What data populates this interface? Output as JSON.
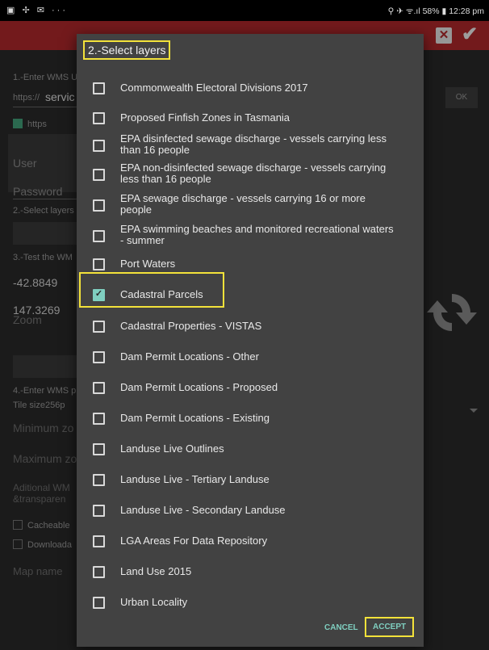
{
  "status_bar": {
    "left_icons": "▣ ✢ ✉ ···",
    "right": "⚲ ✈ ᯤ.ıl 58% ▮ 12:28 pm"
  },
  "app_bar": {
    "discard_icon": "x-box-icon",
    "confirm_icon": "check-icon"
  },
  "background_form": {
    "enter_wms_label": "1.-Enter WMS U",
    "url_prefix": "https://",
    "url_value": "servic",
    "ok_label": "OK",
    "https_label": "https",
    "user_placeholder": "User",
    "password_placeholder": "Password",
    "select_layers_label": "2.-Select layers",
    "test_label": "3.-Test the WM",
    "lat": "-42.8849",
    "lon": "147.3269",
    "zoom_placeholder": "Zoom",
    "enter_wms_p_label": "4.-Enter WMS p",
    "tile_size_label": "Tile size",
    "tile_size_value": "256p",
    "min_zoom_placeholder": "Minimum zo",
    "max_zoom_placeholder": "Maximum zo",
    "additional_label_1": "Aditional WM",
    "additional_label_2": "&transparen",
    "cacheable_label": "Cacheable",
    "downloadable_label": "Downloada",
    "map_name_placeholder": "Map name"
  },
  "dialog": {
    "title": "2.-Select layers",
    "layers": [
      {
        "label": "Commonwealth Electoral Divisions 2017",
        "checked": false
      },
      {
        "label": "Proposed Finfish Zones in Tasmania",
        "checked": false
      },
      {
        "label": "EPA disinfected sewage discharge - vessels carrying less than 16 people",
        "checked": false
      },
      {
        "label": "EPA non-disinfected sewage discharge - vessels carrying less than 16 people",
        "checked": false
      },
      {
        "label": "EPA sewage discharge - vessels carrying 16 or more people",
        "checked": false
      },
      {
        "label": "EPA swimming beaches and monitored recreational waters - summer",
        "checked": false
      },
      {
        "label": "Port Waters",
        "checked": false
      },
      {
        "label": "Cadastral Parcels",
        "checked": true
      },
      {
        "label": "Cadastral Properties - VISTAS",
        "checked": false
      },
      {
        "label": "Dam Permit Locations - Other",
        "checked": false
      },
      {
        "label": "Dam Permit Locations - Proposed",
        "checked": false
      },
      {
        "label": "Dam Permit Locations - Existing",
        "checked": false
      },
      {
        "label": "Landuse Live Outlines",
        "checked": false
      },
      {
        "label": "Landuse Live - Tertiary Landuse",
        "checked": false
      },
      {
        "label": "Landuse Live - Secondary Landuse",
        "checked": false
      },
      {
        "label": "LGA Areas For Data Repository",
        "checked": false
      },
      {
        "label": "Land Use 2015",
        "checked": false
      },
      {
        "label": "Urban Locality",
        "checked": false
      }
    ],
    "cancel_label": "CANCEL",
    "accept_label": "ACCEPT"
  },
  "colors": {
    "app_bar": "#b1282b",
    "accent": "#7fcfc0",
    "highlight": "#f3e23a",
    "dialog_bg": "#424242"
  }
}
